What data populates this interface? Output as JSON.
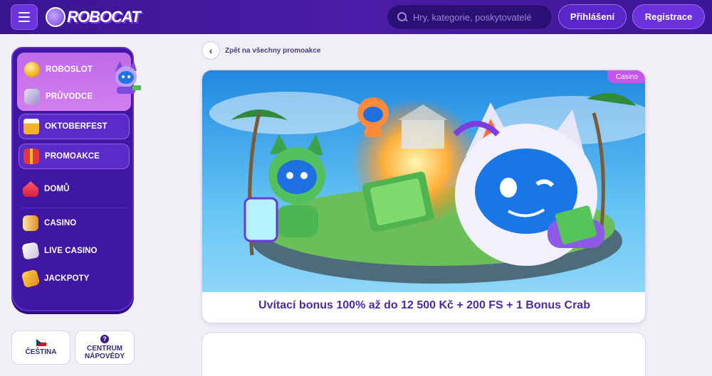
{
  "header": {
    "logo_text": "ROBOCAT",
    "search_placeholder": "Hry, kategorie, poskytovatelé",
    "login_label": "Přihlášení",
    "register_label": "Registrace"
  },
  "sidebar": {
    "top_items": [
      {
        "label": "ROBOSLOT",
        "icon": "coin-icon"
      },
      {
        "label": "PRŮVODCE",
        "icon": "gift-box-icon"
      }
    ],
    "highlight_items": [
      {
        "label": "OKTOBERFEST",
        "icon": "beer-mug-icon"
      },
      {
        "label": "PROMOAKCE",
        "icon": "gift-icon"
      }
    ],
    "home_item": {
      "label": "DOMŮ",
      "icon": "house-icon"
    },
    "game_items": [
      {
        "label": "CASINO",
        "icon": "slot-machine-icon"
      },
      {
        "label": "LIVE CASINO",
        "icon": "cards-icon"
      },
      {
        "label": "JACKPOTY",
        "icon": "jackpot-icon"
      }
    ]
  },
  "footer_boxes": {
    "language": "ČEŠTINA",
    "help_line1": "CENTRUM",
    "help_line2": "NÁPOVĚDY"
  },
  "main": {
    "back_label": "Zpět na všechny promoakce",
    "promo": {
      "badge": "Casino",
      "title": "Uvítací bonus 100% až do 12 500 Kč + 200 FS + 1 Bonus Crab"
    }
  },
  "colors": {
    "header_bg": "#3f1799",
    "sidebar_bg": "#3f17a3",
    "accent": "#6b31de",
    "promo_title": "#4a2aa6",
    "badge": "#c457e8"
  }
}
